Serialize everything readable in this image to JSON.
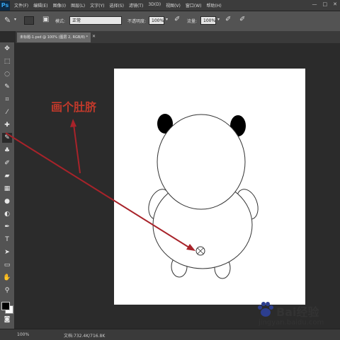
{
  "app": {
    "logo": "Ps"
  },
  "menubar": {
    "items": [
      "文件(F)",
      "编辑(E)",
      "图像(I)",
      "图层(L)",
      "文字(Y)",
      "选择(S)",
      "滤镜(T)",
      "3D(D)",
      "视图(V)",
      "窗口(W)",
      "帮助(H)"
    ],
    "window_buttons": [
      "—",
      "□",
      "✕"
    ]
  },
  "options_bar": {
    "mode_label": "模式:",
    "mode_value": "正常",
    "opacity_label": "不透明度:",
    "opacity_value": "100%",
    "flow_label": "流量:",
    "flow_value": "100%"
  },
  "document": {
    "tab_title": "未标题-1.psd @ 100% (图层 2, RGB/8) *"
  },
  "status": {
    "zoom": "100%",
    "doc_size": "文档:732.4K/716.8K"
  },
  "annotation": {
    "text": "画个肚脐",
    "color": "#c0392b"
  },
  "watermark": {
    "brand": "Bai",
    "brand_suffix": "经验",
    "url": "jingyan.baidu.com"
  },
  "icons": [
    "brush-icon",
    "move-icon",
    "marquee-icon",
    "lasso-icon",
    "quick-select-icon",
    "crop-icon",
    "eyedropper-icon",
    "healing-icon",
    "brush-tool-icon",
    "stamp-icon",
    "history-brush-icon",
    "eraser-icon",
    "gradient-icon",
    "blur-icon",
    "dodge-icon",
    "pen-icon",
    "type-icon",
    "path-select-icon",
    "shape-icon",
    "hand-icon",
    "zoom-icon"
  ]
}
